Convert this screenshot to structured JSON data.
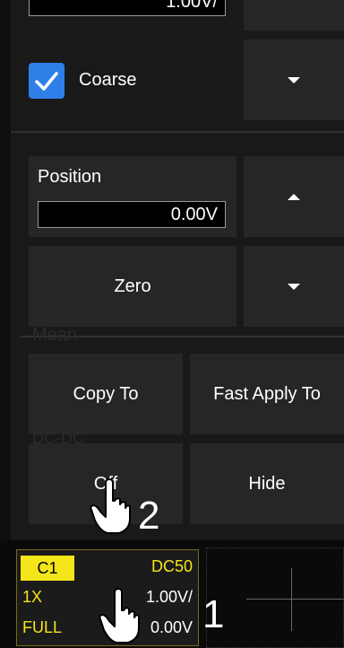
{
  "scale_field_partial": "1.00V/",
  "coarse": {
    "label": "Coarse",
    "checked": true
  },
  "position": {
    "title": "Position",
    "value": "0.00V"
  },
  "zero_label": "Zero",
  "ghost": {
    "mean": "Mean",
    "dc_dc": "DC-DC"
  },
  "copy_to_label": "Copy To",
  "fast_apply_label": "Fast Apply To",
  "off_label": "Off",
  "hide_label": "Hide",
  "channel": {
    "name": "C1",
    "coupling": "DC50",
    "probe": "1X",
    "bandwidth": "FULL",
    "scale": "1.00V/",
    "offset": "0.00V"
  },
  "steps": [
    "1",
    "2"
  ],
  "colors": {
    "accent_yellow": "#f5e51b",
    "checkbox_blue": "#2e7fe8"
  }
}
